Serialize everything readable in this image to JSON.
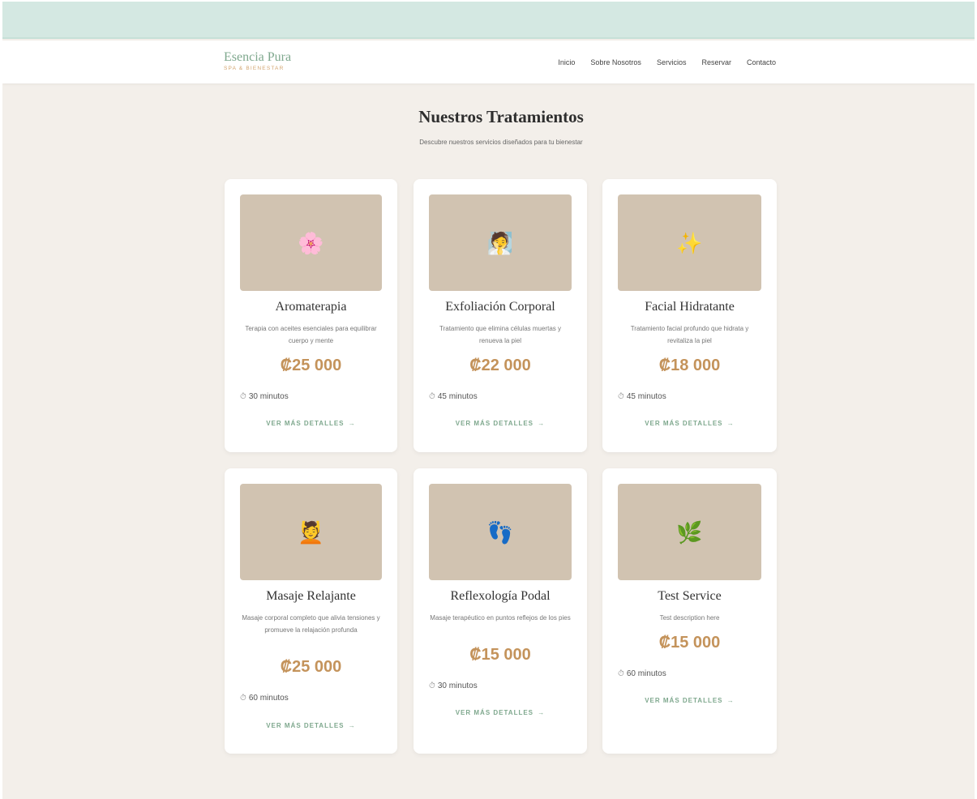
{
  "brand": {
    "name": "Esencia Pura",
    "tagline": "SPA & BIENESTAR"
  },
  "nav": [
    "Inicio",
    "Sobre Nosotros",
    "Servicios",
    "Reservar",
    "Contacto"
  ],
  "section": {
    "title": "Nuestros Tratamientos",
    "subtitle": "Descubre nuestros servicios diseñados para tu bienestar"
  },
  "link_label": "VER MÁS DETALLES",
  "link_arrow": "→",
  "clock_glyph": "⏱",
  "cards": [
    {
      "icon": "🌸",
      "icon_name": "flower-icon",
      "title": "Aromaterapia",
      "desc": "Terapia con aceites esenciales para equilibrar cuerpo y mente",
      "price": "₡25 000",
      "duration": "30 minutos"
    },
    {
      "icon": "🧖",
      "icon_name": "spa-person-icon",
      "title": "Exfoliación Corporal",
      "desc": "Tratamiento que elimina células muertas y renueva la piel",
      "price": "₡22 000",
      "duration": "45 minutos"
    },
    {
      "icon": "✨",
      "icon_name": "sparkles-icon",
      "title": "Facial Hidratante",
      "desc": "Tratamiento facial profundo que hidrata y revitaliza la piel",
      "price": "₡18 000",
      "duration": "45 minutos"
    },
    {
      "icon": "💆",
      "icon_name": "massage-icon",
      "title": "Masaje Relajante",
      "desc": "Masaje corporal completo que alivia tensiones y promueve la relajación profunda",
      "price": "₡25 000",
      "duration": "60 minutos"
    },
    {
      "icon": "👣",
      "icon_name": "footprints-icon",
      "title": "Reflexología Podal",
      "desc": "Masaje terapéutico en puntos reflejos de los pies",
      "price": "₡15 000",
      "duration": "30 minutos"
    },
    {
      "icon": "🌿",
      "icon_name": "herb-icon",
      "title": "Test Service",
      "desc": "Test description here",
      "price": "₡15 000",
      "duration": "60 minutos"
    }
  ],
  "colors": {
    "accent_green": "#7fa88e",
    "price_gold": "#c4935b",
    "top_band": "#d4e8e2",
    "page_bg": "#f3efea",
    "image_placeholder": "#d1c3b1"
  }
}
